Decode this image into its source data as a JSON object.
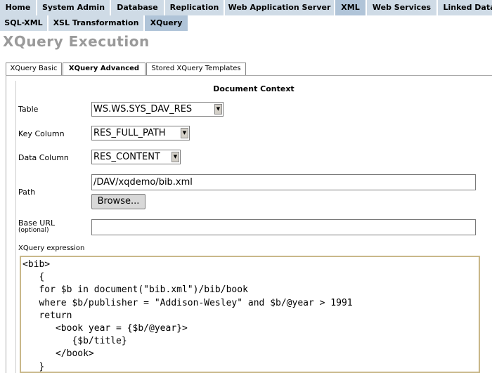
{
  "top_nav": [
    {
      "label": "Home"
    },
    {
      "label": "System Admin"
    },
    {
      "label": "Database"
    },
    {
      "label": "Replication"
    },
    {
      "label": "Web Application Server"
    },
    {
      "label": "XML"
    },
    {
      "label": "Web Services"
    },
    {
      "label": "Linked Data"
    }
  ],
  "sub_nav": [
    {
      "label": "SQL-XML"
    },
    {
      "label": "XSL Transformation"
    },
    {
      "label": "XQuery"
    }
  ],
  "page_title": "XQuery Execution",
  "panel_tabs": [
    {
      "label": "XQuery Basic"
    },
    {
      "label": "XQuery Advanced"
    },
    {
      "label": "Stored XQuery Templates"
    }
  ],
  "section_title": "Document Context",
  "form": {
    "table_label": "Table",
    "table_value": "WS.WS.SYS_DAV_RES",
    "key_column_label": "Key Column",
    "key_column_value": "RES_FULL_PATH",
    "data_column_label": "Data Column",
    "data_column_value": "RES_CONTENT",
    "path_label": "Path",
    "path_value": "/DAV/xqdemo/bib.xml",
    "browse_label": "Browse...",
    "base_url_label": "Base URL",
    "base_url_note": "(optional)",
    "base_url_value": "",
    "xquery_label": "XQuery expression",
    "xquery_value": "<bib>\n   {\n   for $b in document(\"bib.xml\")/bib/book\n   where $b/publisher = \"Addison-Wesley\" and $b/@year > 1991\n   return\n      <book year = {$b/@year}>\n         {$b/title}\n      </book>\n   }\n</bib>"
  }
}
